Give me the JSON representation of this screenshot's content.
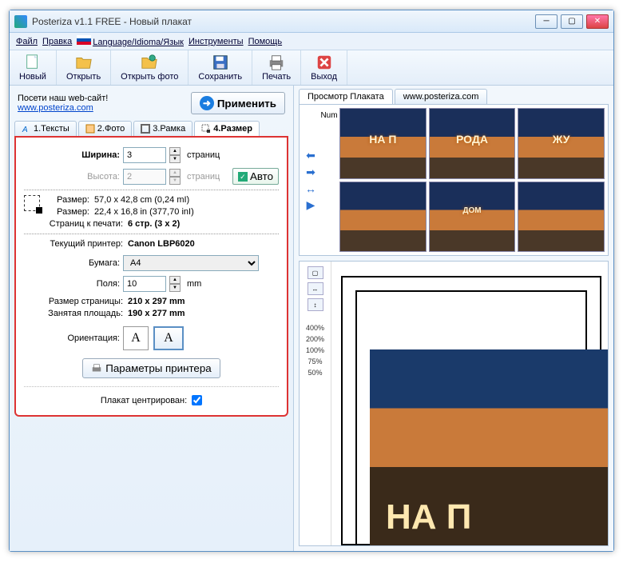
{
  "window": {
    "title": "Posteriza v1.1 FREE - Новый плакат"
  },
  "menu": {
    "file": "Файл",
    "edit": "Правка",
    "language": "Language/Idioma/Язык",
    "tools": "Инструменты",
    "help": "Помощь"
  },
  "toolbar": {
    "new": "Новый",
    "open": "Открыть",
    "open_photo": "Открыть фото",
    "save": "Сохранить",
    "print": "Печать",
    "exit": "Выход"
  },
  "left": {
    "visit_label": "Посети наш web-сайт!",
    "visit_url": "www.posteriza.com",
    "apply": "Применить",
    "tabs": {
      "texts": "1.Тексты",
      "photo": "2.Фото",
      "frame": "3.Рамка",
      "size": "4.Размер"
    },
    "size_panel": {
      "width_label": "Ширина:",
      "width_value": "3",
      "width_unit": "страниц",
      "height_label": "Высота:",
      "height_value": "2",
      "height_unit": "страниц",
      "auto": "Авто",
      "size_cm_label": "Размер:",
      "size_cm": "57,0 x 42,8 cm (0,24 mI)",
      "size_in_label": "Размер:",
      "size_in": "22,4 x 16,8 in (377,70 inI)",
      "pages_label": "Страниц к печати:",
      "pages": "6 стр. (3 x 2)",
      "printer_label": "Текущий принтер:",
      "printer": "Canon LBP6020",
      "paper_label": "Бумага:",
      "paper": "A4",
      "margin_label": "Поля:",
      "margin_value": "10",
      "margin_unit": "mm",
      "page_size_label": "Размер страницы:",
      "page_size": "210 x 297 mm",
      "used_area_label": "Занятая площадь:",
      "used_area": "190 x 277 mm",
      "orientation_label": "Ориентация:",
      "printer_settings": "Параметры принтера",
      "centered_label": "Плакат центрирован:"
    }
  },
  "right": {
    "tab_preview": "Просмотр Плаката",
    "tab_site": "www.posteriza.com",
    "num_label": "Num",
    "thumbs": {
      "t1": "НА П",
      "t2": "РОДА",
      "t3": "ЖУ",
      "t4": "",
      "t5": "ДОМ",
      "t6": ""
    },
    "zoom": {
      "z400": "400%",
      "z200": "200%",
      "z100": "100%",
      "z75": "75%",
      "z50": "50%"
    },
    "poster_text": "НА П"
  }
}
